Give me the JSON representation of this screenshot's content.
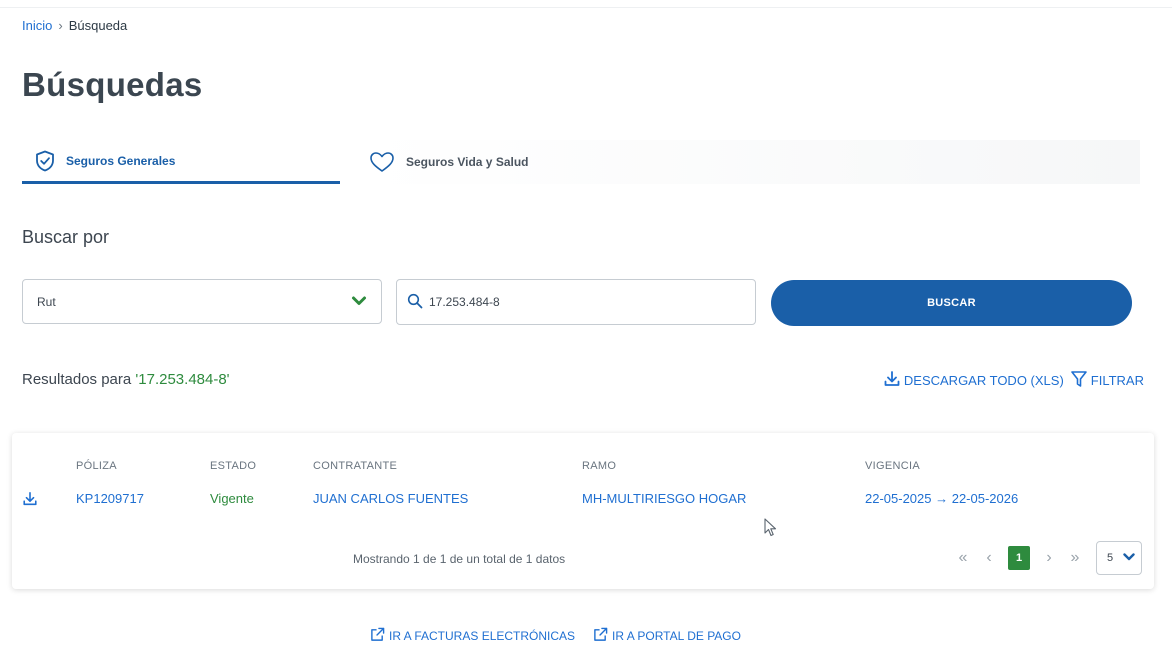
{
  "breadcrumb": {
    "home": "Inicio",
    "separator": "›",
    "current": "Búsqueda"
  },
  "page": {
    "title": "Búsquedas"
  },
  "tabs": [
    {
      "label": "Seguros Generales",
      "icon": "shield-check-icon",
      "active": true
    },
    {
      "label": "Seguros Vida y Salud",
      "icon": "heart-icon",
      "active": false
    }
  ],
  "search": {
    "label": "Buscar por",
    "type_value": "Rut",
    "query_value": "17.253.484-8",
    "button_label": "BUSCAR"
  },
  "results": {
    "prefix": "Resultados para ",
    "term": "'17.253.484-8'",
    "download_label": "DESCARGAR TODO (XLS)",
    "filter_label": "FILTRAR"
  },
  "table": {
    "columns": [
      "PÓLIZA",
      "ESTADO",
      "CONTRATANTE",
      "RAMO",
      "VIGENCIA"
    ],
    "rows": [
      {
        "poliza": "KP1209717",
        "estado": "Vigente",
        "contratante": "JUAN CARLOS FUENTES",
        "ramo": "MH-MULTIRIESGO HOGAR",
        "vigencia": "22-05-2025 → 22-05-2026"
      }
    ],
    "summary": "Mostrando 1 de 1 de un total de 1 datos",
    "pagination": {
      "first": "«",
      "prev": "‹",
      "current_page": "1",
      "next": "›",
      "last": "»",
      "page_size": "5"
    }
  },
  "footer_links": {
    "facturas": "IR A FACTURAS ELECTRÓNICAS",
    "portal": "IR A PORTAL DE PAGO"
  },
  "colors": {
    "primary": "#1a5fa8",
    "link": "#1f6fd1",
    "success": "#2e8b3e",
    "title": "#3b4650"
  }
}
